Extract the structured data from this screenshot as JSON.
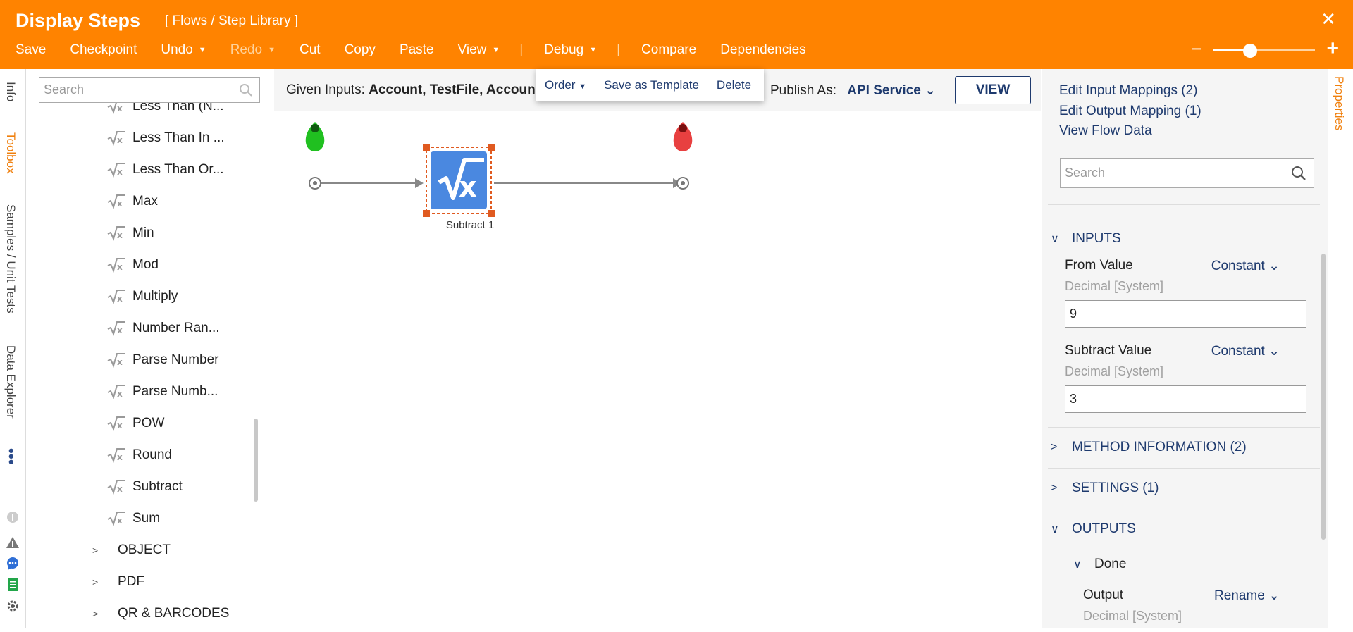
{
  "header": {
    "title": "Display Steps",
    "breadcrumb": "[ Flows / Step Library ]",
    "close": "✕",
    "menu": {
      "save": "Save",
      "checkpoint": "Checkpoint",
      "undo": "Undo",
      "redo": "Redo",
      "cut": "Cut",
      "copy": "Copy",
      "paste": "Paste",
      "view": "View",
      "debug": "Debug",
      "compare": "Compare",
      "dependencies": "Dependencies"
    },
    "zoom": {
      "minus": "−",
      "plus": "+",
      "level": 0.3
    }
  },
  "left_tabs": {
    "info": "Info",
    "toolbox": "Toolbox",
    "samples": "Samples / Unit Tests",
    "data_explorer": "Data Explorer"
  },
  "toolbox": {
    "search_placeholder": "Search",
    "items": [
      "Less Than (N...",
      "Less Than In ...",
      "Less Than Or...",
      "Max",
      "Min",
      "Mod",
      "Multiply",
      "Number Ran...",
      "Parse Number",
      "Parse Numb...",
      "POW",
      "Round",
      "Subtract",
      "Sum"
    ],
    "categories": [
      "OBJECT",
      "PDF",
      "QR & BARCODES"
    ]
  },
  "canvas_bar": {
    "given_label": "Given Inputs:",
    "given_value": "Account, TestFile, Account",
    "publish_label": "Publish As:",
    "publish_value": "API Service",
    "view_button": "VIEW"
  },
  "context_menu": {
    "order": "Order",
    "save_template": "Save as Template",
    "delete": "Delete"
  },
  "canvas": {
    "step_label": "Subtract 1",
    "colors": {
      "start": "#20c020",
      "end": "#e84040",
      "step": "#4a88e0",
      "selection": "#e05a20"
    }
  },
  "properties": {
    "tab_label": "Properties",
    "links": [
      "Edit Input Mappings (2)",
      "Edit Output Mapping (1)",
      "View Flow Data"
    ],
    "search_placeholder": "Search",
    "inputs_title": "INPUTS",
    "from_value": {
      "label": "From Value",
      "mode": "Constant",
      "type": "Decimal [System]",
      "value": "9"
    },
    "subtract_value": {
      "label": "Subtract Value",
      "mode": "Constant",
      "type": "Decimal [System]",
      "value": "3"
    },
    "method_info": "METHOD INFORMATION (2)",
    "settings": "SETTINGS (1)",
    "outputs_title": "OUTPUTS",
    "done": "Done",
    "output": {
      "label": "Output",
      "mode": "Rename",
      "type": "Decimal [System]"
    }
  }
}
